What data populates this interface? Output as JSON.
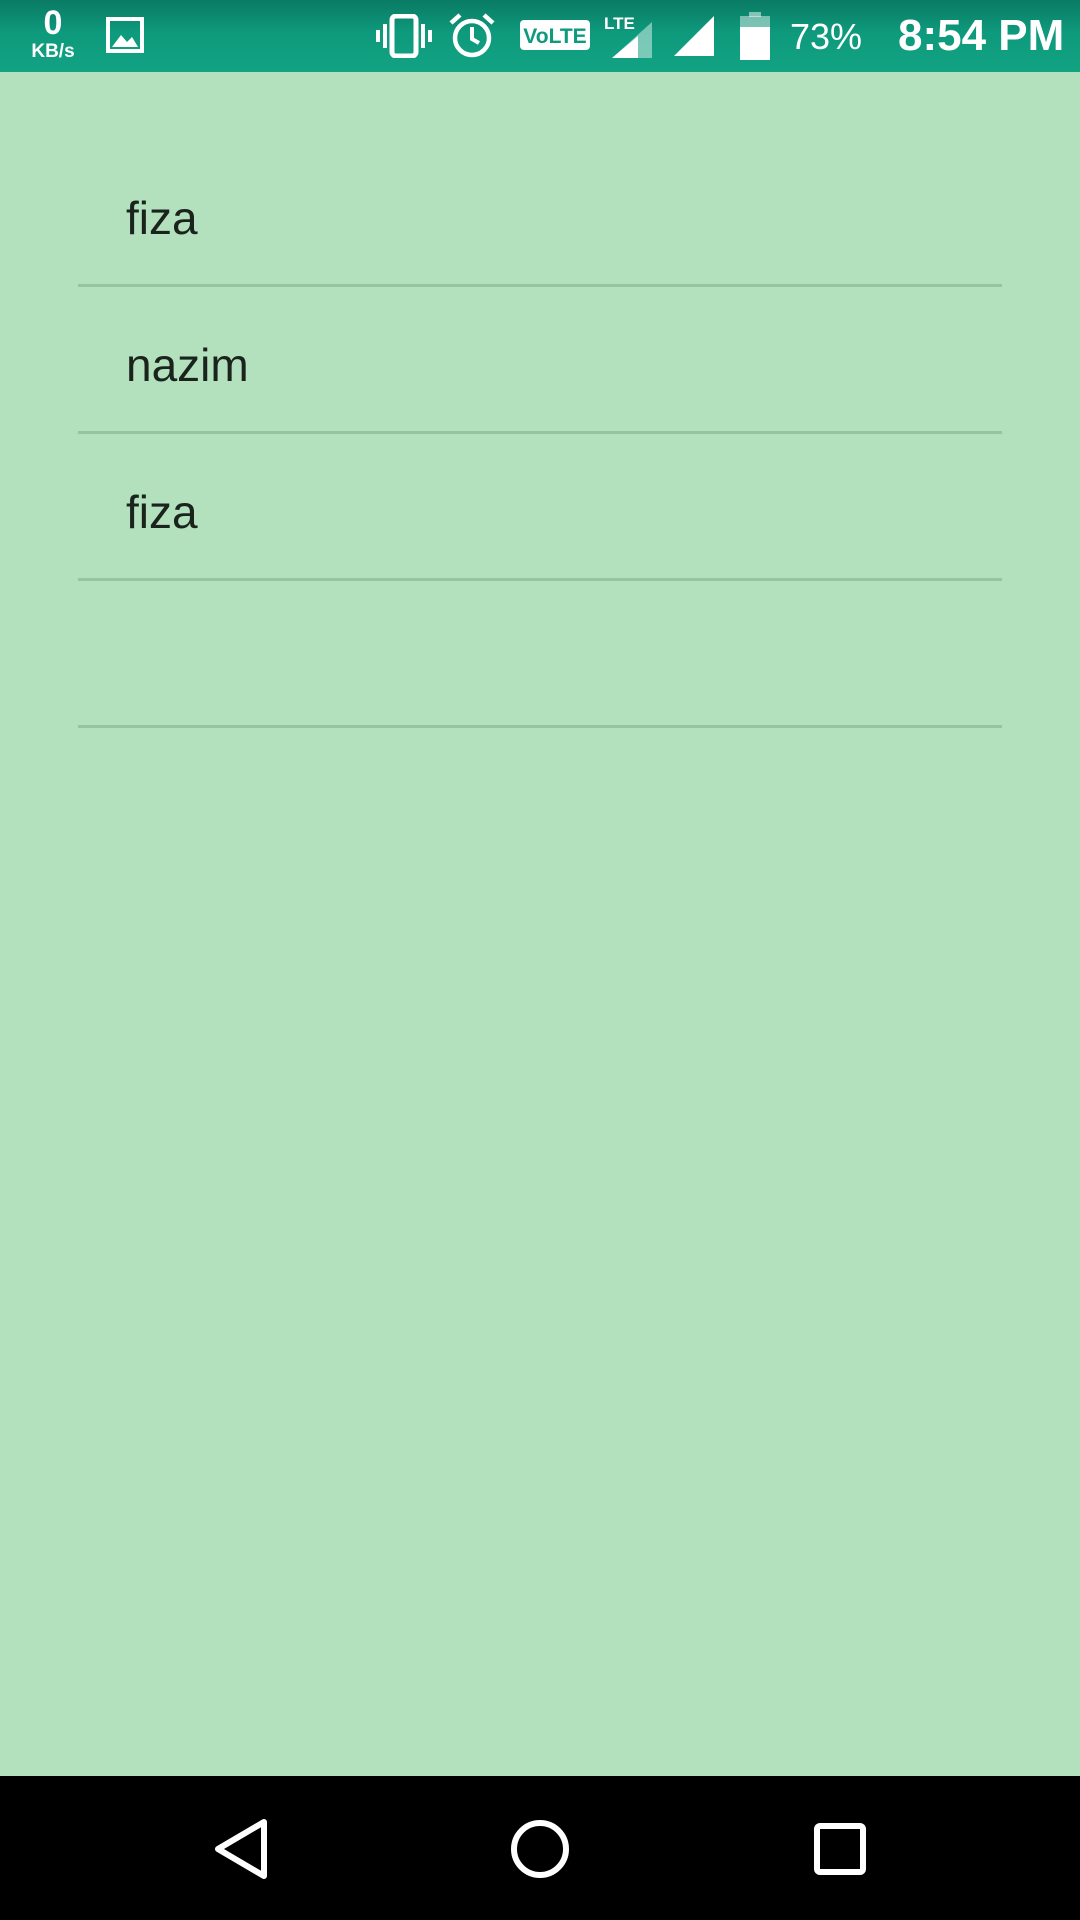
{
  "status_bar": {
    "net_speed_value": "0",
    "net_speed_unit": "KB/s",
    "battery_percent": "73%",
    "time": "8:54 PM",
    "icons": [
      "image-notification-icon",
      "vibrate-icon",
      "alarm-icon",
      "volte-icon",
      "lte-signal-icon",
      "signal-icon",
      "battery-icon"
    ]
  },
  "list": {
    "items": [
      {
        "label": "fiza"
      },
      {
        "label": "nazim"
      },
      {
        "label": "fiza"
      },
      {
        "label": ""
      }
    ]
  },
  "nav_bar": {
    "buttons": [
      "back-icon",
      "home-icon",
      "recents-icon"
    ]
  },
  "colors": {
    "background": "#b3e1bd",
    "status_bar": "#0e9a7c",
    "divider": "#95c4a2",
    "text": "#1b231d",
    "nav_bar": "#000000"
  }
}
